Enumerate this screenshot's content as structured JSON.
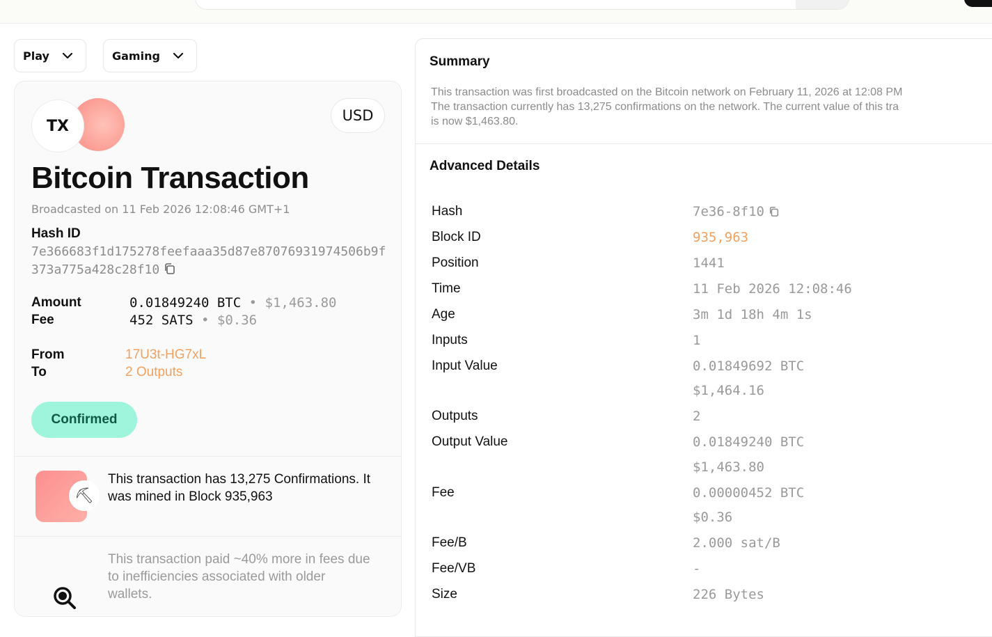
{
  "dropdowns": {
    "play_label": "Play",
    "gaming_label": "Gaming"
  },
  "tx_card": {
    "logo_text": "TX",
    "currency": "USD",
    "title": "Bitcoin Transaction",
    "broadcasted": "Broadcasted on 11 Feb 2026 12:08:46 GMT+1",
    "hash_label": "Hash ID",
    "hash_value": "7e366683f1d175278feefaaa35d87e87076931974506b9f373a775a428c28f10",
    "amount_label": "Amount",
    "amount_btc": "0.01849240 BTC",
    "amount_sep": "•",
    "amount_usd": "$1,463.80",
    "fee_label": "Fee",
    "fee_sats": "452 SATS",
    "fee_sep": "•",
    "fee_usd": "$0.36",
    "from_label": "From",
    "from_value": "17U3t-HG7xL",
    "to_label": "To",
    "to_value": "2 Outputs",
    "status": "Confirmed",
    "confirm_info": "This transaction has 13,275 Confirmations. It was mined in Block 935,963",
    "fee_info": "This transaction paid ~40% more in fees due to inefficiencies associated with older wallets."
  },
  "summary": {
    "title": "Summary",
    "line1": "This transaction was first broadcasted on the Bitcoin network on February 11, 2026 at 12:08 PM",
    "line2": "The transaction currently has 13,275 confirmations on the network. The current value of this tra",
    "line3": "is now $1,463.80."
  },
  "advanced": {
    "title": "Advanced Details",
    "rows": [
      {
        "label": "Hash",
        "value": "7e36-8f10"
      },
      {
        "label": "Block ID",
        "value": "935,963"
      },
      {
        "label": "Position",
        "value": "1441"
      },
      {
        "label": "Time",
        "value": "11 Feb 2026 12:08:46"
      },
      {
        "label": "Age",
        "value": "3m 1d 18h 4m 1s"
      },
      {
        "label": "Inputs",
        "value": "1"
      },
      {
        "label": "Input Value",
        "value": "0.01849692 BTC",
        "value2": "$1,464.16"
      },
      {
        "label": "Outputs",
        "value": "2"
      },
      {
        "label": "Output Value",
        "value": "0.01849240 BTC",
        "value2": "$1,463.80"
      },
      {
        "label": "Fee",
        "value": "0.00000452 BTC",
        "value2": "$0.36"
      },
      {
        "label": "Fee/B",
        "value": "2.000 sat/B"
      },
      {
        "label": "Fee/VB",
        "value": "-"
      },
      {
        "label": "Size",
        "value": "226 Bytes"
      }
    ]
  },
  "colors": {
    "accent_orange": "#f2a160",
    "confirmed_bg": "#9ef5dc",
    "confirmed_text": "#0f5a45"
  },
  "icons": {
    "copy": "copy-icon",
    "chevron": "chevron-down-icon",
    "pickaxe": "pickaxe-icon",
    "magnifier": "magnifier-icon"
  }
}
